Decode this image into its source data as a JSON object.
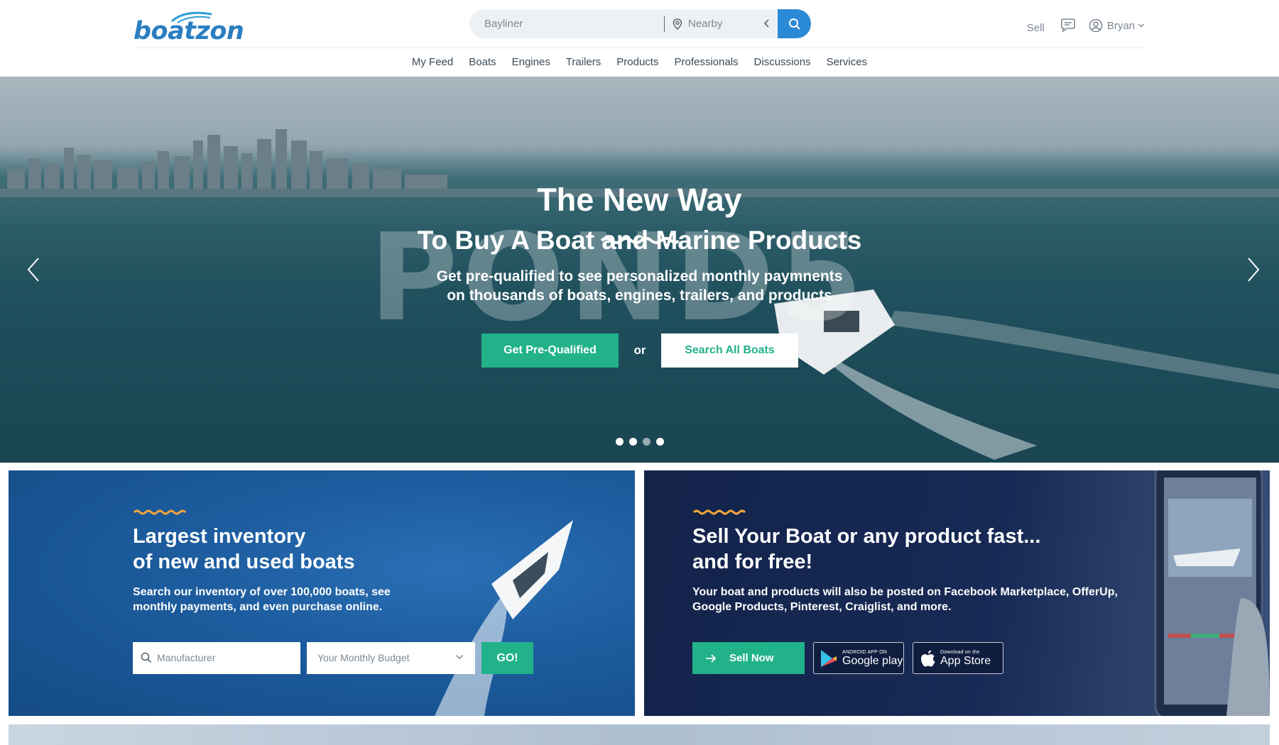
{
  "header": {
    "logo": "boatzon",
    "search": {
      "keyword": "Bayliner",
      "location": "Nearby"
    },
    "user_nav": {
      "sell": "Sell",
      "username": "Bryan"
    }
  },
  "nav": [
    "My Feed",
    "Boats",
    "Engines",
    "Trailers",
    "Products",
    "Professionals",
    "Discussions",
    "Services"
  ],
  "hero": {
    "watermark": "POND5",
    "title": "The New Way",
    "subtitle": "To Buy A Boat and Marine Products",
    "description_line1": "Get pre-qualified to see personalized monthly paymnents",
    "description_line2": "on thousands of boats, engines, trailers, and products",
    "cta_primary": "Get Pre-Qualified",
    "cta_or": "or",
    "cta_secondary": "Search All Boats",
    "slides": 4,
    "active_slide": 3
  },
  "cards": {
    "inventory": {
      "title_line1": "Largest inventory",
      "title_line2": "of new and used boats",
      "text": "Search our inventory of over 100,000 boats, see monthly payments, and even purchase online.",
      "manufacturer_placeholder": "Manufacturer",
      "budget_placeholder": "Your Monthly Budget",
      "go_label": "GO!"
    },
    "sell": {
      "title_line1": "Sell Your Boat or any product fast...",
      "title_line2": "and for free!",
      "text": "Your boat and products will also be posted on Facebook Marketplace, OfferUp, Google Products, Pinterest, Craiglist, and more.",
      "sell_now": "Sell Now",
      "google_small": "ANDROID APP ON",
      "google_big": "Google play",
      "apple_small": "Download on the",
      "apple_big": "App Store"
    }
  },
  "colors": {
    "brand_blue": "#2b7fc1",
    "accent_green": "#22b28a",
    "squiggle_orange": "#f0a53a"
  }
}
